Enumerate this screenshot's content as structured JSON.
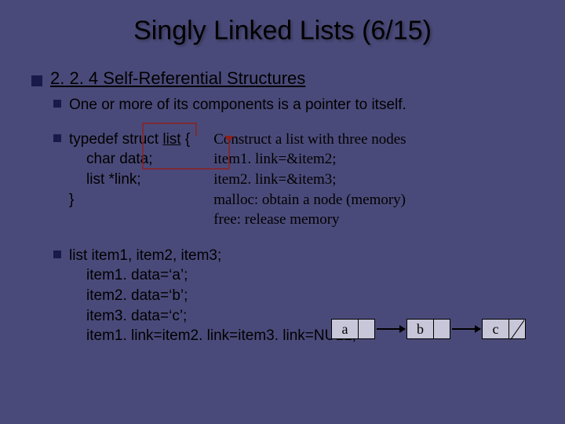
{
  "title": "Singly Linked Lists (6/15)",
  "section": "2. 2. 4 Self-Referential Structures",
  "sub1": "One or more of its components is a pointer to itself.",
  "typedef": {
    "line1": "typedef struct list {",
    "line2": "char data;",
    "line3": "list *link;",
    "line4": "}"
  },
  "right": {
    "l1": "Construct a list with three nodes",
    "l2": "item1. link=&item2;",
    "l3": "item2. link=&item3;",
    "l4": "malloc: obtain a node (memory)",
    "l5": "free: release memory"
  },
  "decl": {
    "l1": "list item1, item2, item3;",
    "l2": "item1. data=‘a’;",
    "l3": "item2. data=‘b’;",
    "l4": "item3. data=‘c’;",
    "l5": "item1. link=item2. link=item3. link=NULL;"
  },
  "nodes": {
    "a": "a",
    "b": "b",
    "c": "c"
  }
}
